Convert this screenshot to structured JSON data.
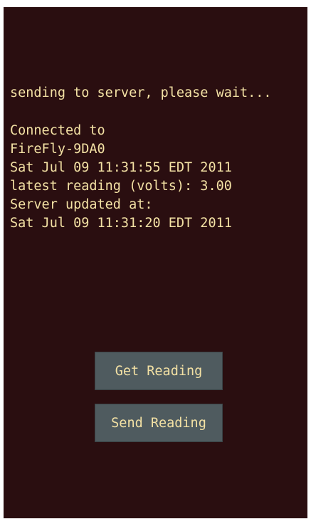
{
  "status": {
    "message": "sending to server, please wait..."
  },
  "info": {
    "lines": [
      "Connected to",
      "FireFly-9DA0",
      "Sat Jul 09 11:31:55 EDT 2011",
      "latest reading (volts): 3.00",
      "Server updated at:",
      "Sat Jul 09 11:31:20 EDT 2011"
    ]
  },
  "buttons": {
    "get_reading": "Get Reading",
    "send_reading": "Send Reading"
  },
  "colors": {
    "background": "#2a0e10",
    "text": "#f3e1a4",
    "button": "#4f5b5f"
  }
}
